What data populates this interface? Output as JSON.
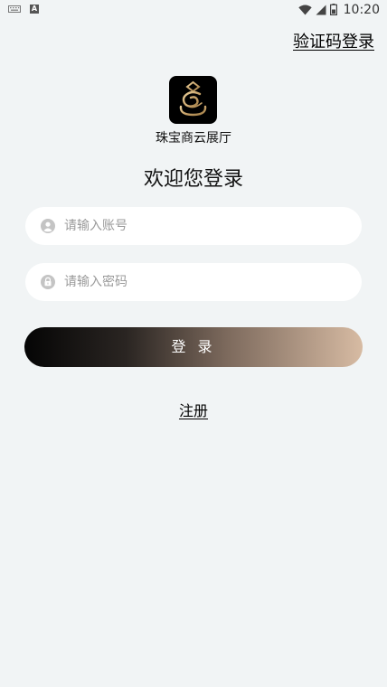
{
  "status_bar": {
    "time": "10:20",
    "left_icons": [
      "keyboard-icon",
      "a-icon"
    ],
    "a_icon_text": "A",
    "right_icons": [
      "wifi-icon",
      "signal-icon",
      "battery-icon"
    ]
  },
  "header": {
    "code_login_label": "验证码登录"
  },
  "brand": {
    "app_name": "珠宝商云展厅",
    "logo_icon": "ring-logo-icon",
    "logo_gold": "#c9a46b"
  },
  "form": {
    "title": "欢迎您登录",
    "account_placeholder": "请输入账号",
    "account_value": "",
    "account_icon": "user-icon",
    "password_placeholder": "请输入密码",
    "password_value": "",
    "password_icon": "lock-icon",
    "login_label": "登 录",
    "register_label": "注册"
  },
  "colors": {
    "background": "#f1f4f5",
    "button_gradient_start": "#050505",
    "button_gradient_end": "#d7bba3",
    "icon_gray": "#c4c4c4"
  }
}
